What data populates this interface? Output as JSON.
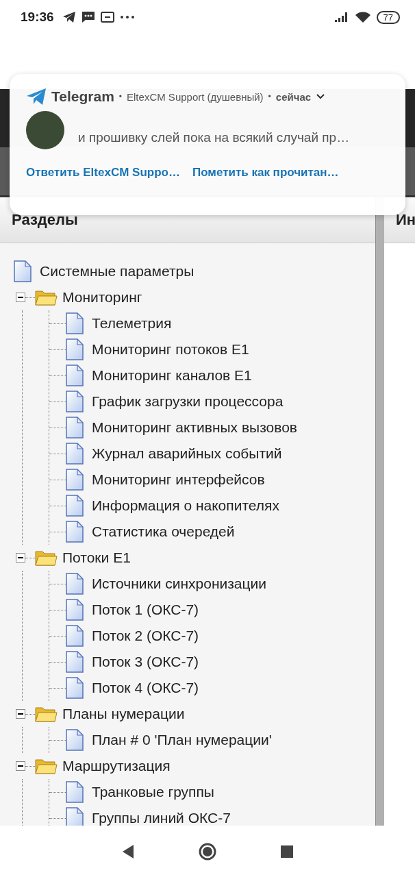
{
  "status_bar": {
    "time": "19:36",
    "battery": "77"
  },
  "notification": {
    "separator": "•",
    "app": "Telegram",
    "sender": "EltexCM Support (душевный)",
    "time": "сейчас",
    "message": "и прошивку слей пока на всякий случай пр…",
    "actions": [
      "Ответить EltexCM Suppo…",
      "Пометить как прочитан…"
    ]
  },
  "left_panel": {
    "title": "Разделы",
    "tree": [
      {
        "kind": "doc",
        "label": "Системные параметры"
      },
      {
        "kind": "folder",
        "label": "Мониторинг",
        "expanded": true,
        "children": [
          {
            "kind": "doc",
            "label": "Телеметрия"
          },
          {
            "kind": "doc",
            "label": "Мониторинг потоков E1"
          },
          {
            "kind": "doc",
            "label": "Мониторинг каналов E1"
          },
          {
            "kind": "doc",
            "label": "График загрузки процессора"
          },
          {
            "kind": "doc",
            "label": "Мониторинг активных вызовов"
          },
          {
            "kind": "doc",
            "label": "Журнал аварийных событий"
          },
          {
            "kind": "doc",
            "label": "Мониторинг интерфейсов"
          },
          {
            "kind": "doc",
            "label": "Информация о накопителях"
          },
          {
            "kind": "doc",
            "label": "Статистика очередей"
          }
        ]
      },
      {
        "kind": "folder",
        "label": "Потоки E1",
        "expanded": true,
        "children": [
          {
            "kind": "doc",
            "label": "Источники синхронизации"
          },
          {
            "kind": "doc",
            "label": "Поток 1 (ОКС-7)"
          },
          {
            "kind": "doc",
            "label": "Поток 2 (ОКС-7)"
          },
          {
            "kind": "doc",
            "label": "Поток 3 (ОКС-7)"
          },
          {
            "kind": "doc",
            "label": "Поток 4 (ОКС-7)"
          }
        ]
      },
      {
        "kind": "folder",
        "label": "Планы нумерации",
        "expanded": true,
        "children": [
          {
            "kind": "doc",
            "label": "План # 0 'План нумерации'"
          }
        ]
      },
      {
        "kind": "folder",
        "label": "Маршрутизация",
        "expanded": true,
        "children": [
          {
            "kind": "doc",
            "label": "Транковые группы"
          },
          {
            "kind": "doc",
            "label": "Группы линий ОКС-7"
          }
        ]
      }
    ]
  },
  "right_panel": {
    "title": "Ин"
  }
}
